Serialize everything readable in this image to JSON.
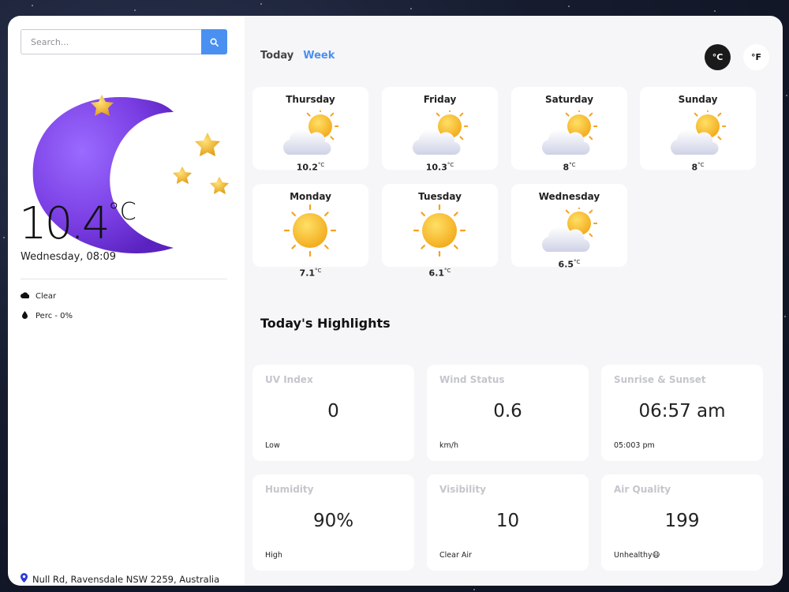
{
  "search": {
    "placeholder": "Search..."
  },
  "current": {
    "temperature": "10.4",
    "unit": "°C",
    "datetime": "Wednesday, 08:09",
    "condition": "Clear",
    "precipitation": "Perc - 0%",
    "location": "Null Rd, Ravensdale NSW 2259, Australia"
  },
  "tabs": {
    "today": "Today",
    "week": "Week"
  },
  "units": {
    "celsius": "°C",
    "fahrenheit": "°F"
  },
  "forecast": [
    {
      "day": "Thursday",
      "temp": "10.2",
      "unit": "°C",
      "icon": "partly-cloudy-icon"
    },
    {
      "day": "Friday",
      "temp": "10.3",
      "unit": "°C",
      "icon": "partly-cloudy-icon"
    },
    {
      "day": "Saturday",
      "temp": "8",
      "unit": "°C",
      "icon": "partly-cloudy-icon"
    },
    {
      "day": "Sunday",
      "temp": "8",
      "unit": "°C",
      "icon": "partly-cloudy-icon"
    },
    {
      "day": "Monday",
      "temp": "7.1",
      "unit": "°C",
      "icon": "sun-icon"
    },
    {
      "day": "Tuesday",
      "temp": "6.1",
      "unit": "°C",
      "icon": "sun-icon"
    },
    {
      "day": "Wednesday",
      "temp": "6.5",
      "unit": "°C",
      "icon": "partly-cloudy-icon"
    }
  ],
  "highlights": {
    "title": "Today's Highlights",
    "cards": [
      {
        "label": "UV Index",
        "value": "0",
        "sub": "Low"
      },
      {
        "label": "Wind Status",
        "value": "0.6",
        "sub": "km/h"
      },
      {
        "label": "Sunrise & Sunset",
        "value": "06:57 am",
        "sub": "05:003 pm"
      },
      {
        "label": "Humidity",
        "value": "90%",
        "sub": "High"
      },
      {
        "label": "Visibility",
        "value": "10",
        "sub": "Clear Air"
      },
      {
        "label": "Air Quality",
        "value": "199",
        "sub": "Unhealthy😷"
      }
    ]
  },
  "colors": {
    "accent": "#4a90f0",
    "moon": "#7b3fe4",
    "star": "#f2b51c",
    "sun": "#f5c518"
  }
}
